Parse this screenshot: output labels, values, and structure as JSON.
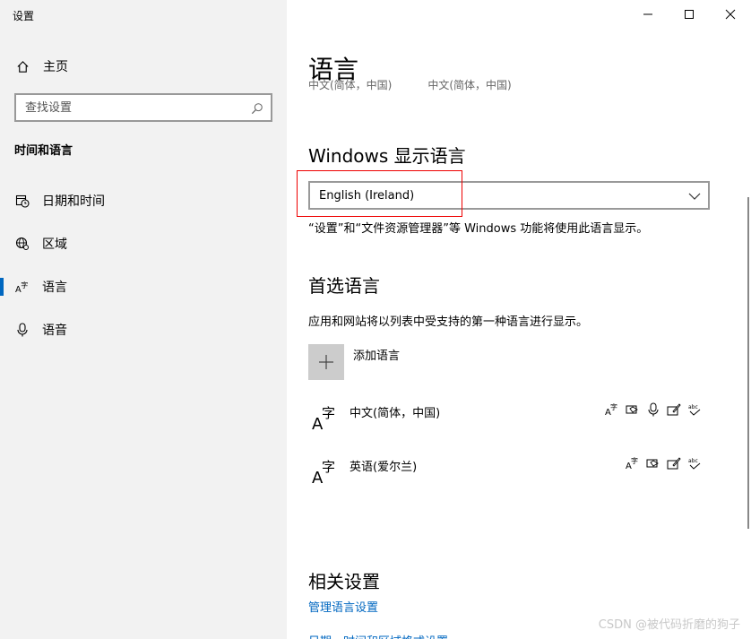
{
  "window": {
    "title": "设置",
    "minimize_icon": "minimize-icon",
    "maximize_icon": "maximize-icon",
    "close_icon": "close-icon"
  },
  "sidebar": {
    "home": {
      "label": "主页",
      "icon": "home-icon"
    },
    "search": {
      "placeholder": "查找设置",
      "icon": "search-icon"
    },
    "section_header": "时间和语言",
    "items": [
      {
        "label": "日期和时间",
        "icon": "calendar-clock-icon",
        "active": false
      },
      {
        "label": "区域",
        "icon": "globe-region-icon",
        "active": false
      },
      {
        "label": "语言",
        "icon": "language-icon",
        "active": true
      },
      {
        "label": "语音",
        "icon": "microphone-icon",
        "active": false
      }
    ]
  },
  "main": {
    "title": "语言",
    "clipped_row": [
      "中文(简体，中国)",
      "中文(简体，中国)"
    ],
    "display_language": {
      "heading": "Windows 显示语言",
      "selected": "English (Ireland)",
      "description": "“设置”和“文件资源管理器”等 Windows 功能将使用此语言显示。"
    },
    "preferred": {
      "heading": "首选语言",
      "description": "应用和网站将以列表中受支持的第一种语言进行显示。",
      "add_label": "添加语言",
      "languages": [
        {
          "name": "中文(简体，中国)",
          "features": [
            "display-language-icon",
            "speech-icon",
            "microphone-icon",
            "handwriting-icon",
            "spellcheck-icon"
          ]
        },
        {
          "name": "英语(爱尔兰)",
          "features": [
            "display-language-icon",
            "speech-icon",
            "handwriting-icon",
            "spellcheck-icon"
          ]
        }
      ]
    },
    "related": {
      "heading": "相关设置",
      "links": [
        "管理语言设置",
        "日期、时间和区域格式设置"
      ]
    }
  },
  "watermark": "CSDN @被代码折磨的狗子",
  "colors": {
    "accent": "#0067c0",
    "highlight": "#e00000",
    "sidebar_bg": "#f2f2f2"
  }
}
